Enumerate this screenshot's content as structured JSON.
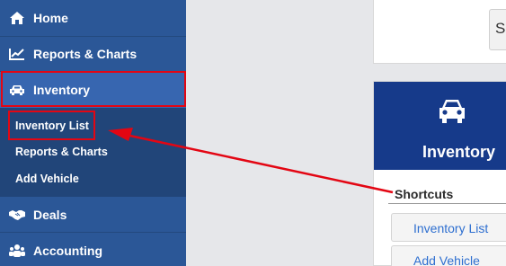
{
  "sidebar": {
    "items": [
      {
        "label": "Home",
        "icon": "home-icon"
      },
      {
        "label": "Reports & Charts",
        "icon": "line-chart-icon"
      },
      {
        "label": "Inventory",
        "icon": "car-icon"
      },
      {
        "label": "Deals",
        "icon": "handshake-icon"
      },
      {
        "label": "Accounting",
        "icon": "users-icon"
      }
    ],
    "submenu": [
      "Inventory List",
      "Reports & Charts",
      "Add Vehicle"
    ]
  },
  "top_button_label": "S",
  "inventory_card": {
    "title": "Inventory",
    "icon": "car-icon",
    "shortcuts_heading": "Shortcuts",
    "shortcuts": [
      "Inventory List",
      "Add Vehicle"
    ]
  },
  "colors": {
    "sidebar": "#2b5797",
    "sidebar_active": "#3766b0",
    "submenu": "#214579",
    "card_header": "#163a8a",
    "highlight": "#e30613",
    "link": "#2e6fd0"
  }
}
